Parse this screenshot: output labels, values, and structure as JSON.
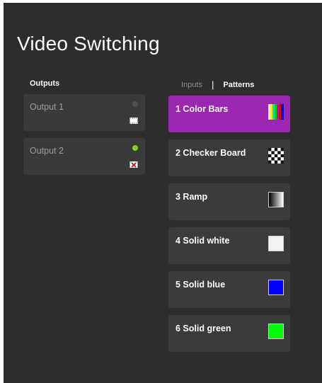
{
  "page": {
    "title": "Video Switching"
  },
  "outputs": {
    "heading": "Outputs",
    "items": [
      {
        "label": "Output 1",
        "status_color": "#505050",
        "icon": "video-frame-icon"
      },
      {
        "label": "Output 2",
        "status_color": "#7ed321",
        "icon": "mute-x-icon"
      }
    ]
  },
  "source_tabs": {
    "inputs_label": "Inputs",
    "separator": "|",
    "patterns_label": "Patterns",
    "active": "Patterns"
  },
  "patterns": [
    {
      "label": "1 Color Bars",
      "selected": true,
      "swatch": "color-bars-swatch"
    },
    {
      "label": "2 Checker Board",
      "selected": false,
      "swatch": "checker-swatch"
    },
    {
      "label": "3 Ramp",
      "selected": false,
      "swatch": "ramp-swatch"
    },
    {
      "label": "4 Solid white",
      "selected": false,
      "swatch": "solid-swatch",
      "color": "#f2f2f2"
    },
    {
      "label": "5 Solid blue",
      "selected": false,
      "swatch": "solid-swatch",
      "color": "#0000ff"
    },
    {
      "label": "6 Solid green",
      "selected": false,
      "swatch": "solid-swatch",
      "color": "#00ff00"
    }
  ],
  "colors": {
    "accent": "#9c27b0",
    "panel": "#2d2d2d",
    "card": "#3b3b3b"
  }
}
